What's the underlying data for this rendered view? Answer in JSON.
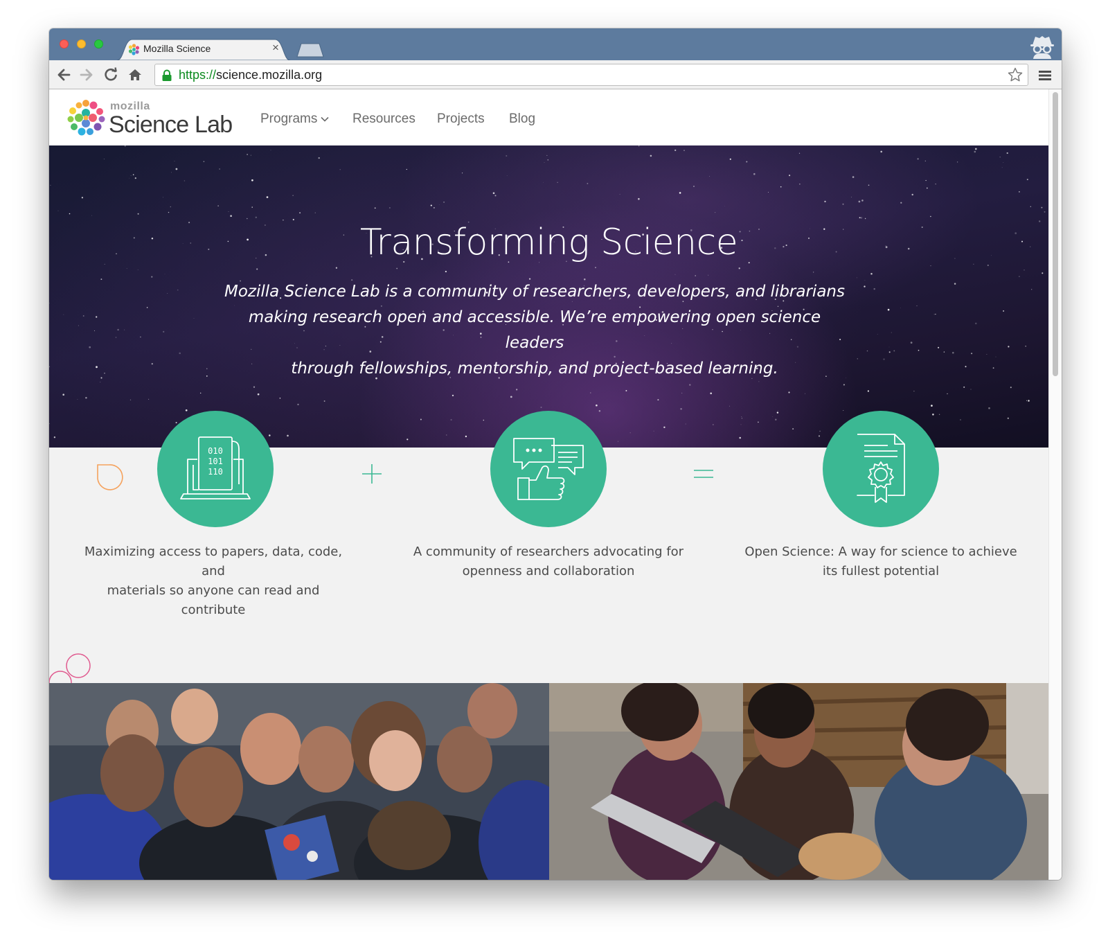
{
  "browser": {
    "tab": {
      "title": "Mozilla Science",
      "close_glyph": "×"
    },
    "address": {
      "scheme": "https://",
      "rest": "science.mozilla.org"
    },
    "icons": {
      "back": "back-arrow-icon",
      "forward": "forward-arrow-icon",
      "reload": "reload-icon",
      "home": "home-icon",
      "lock": "lock-icon",
      "bookmark": "star-icon",
      "menu": "hamburger-menu-icon",
      "profile": "incognito-icon"
    }
  },
  "site": {
    "logo": {
      "small": "mozilla",
      "big": "Science Lab"
    },
    "nav": [
      {
        "label": "Programs",
        "has_dropdown": true
      },
      {
        "label": "Resources"
      },
      {
        "label": "Projects"
      },
      {
        "label": "Blog"
      }
    ],
    "hero": {
      "title": "Transforming Science",
      "subtitle_lines": [
        "Mozilla Science Lab is a community of researchers, developers, and librarians",
        "making research open and accessible. We’re empowering open science leaders",
        "through fellowships, mentorship, and project-based learning."
      ]
    },
    "features": [
      {
        "icon": "laptop-binary-code-icon",
        "text_lines": [
          "Maximizing access to papers, data, code, and",
          "materials so anyone can read and",
          "contribute"
        ]
      },
      {
        "icon": "chat-thumbs-up-icon",
        "text_lines": [
          "A community of researchers advocating for",
          "openness and collaboration"
        ]
      },
      {
        "icon": "certificate-gear-icon",
        "text_lines": [
          "Open Science: A way for science to achieve",
          "its fullest potential"
        ]
      }
    ],
    "binary_rows": [
      "010",
      "101",
      "110"
    ],
    "operators": [
      "plus-icon",
      "equals-icon"
    ],
    "colors": {
      "accent": "#3bb893",
      "hero_dark": "#1d1a35",
      "section_bg": "#f2f2f2",
      "deco_orange": "#f5a25d",
      "deco_pink": "#e05a8f"
    }
  }
}
